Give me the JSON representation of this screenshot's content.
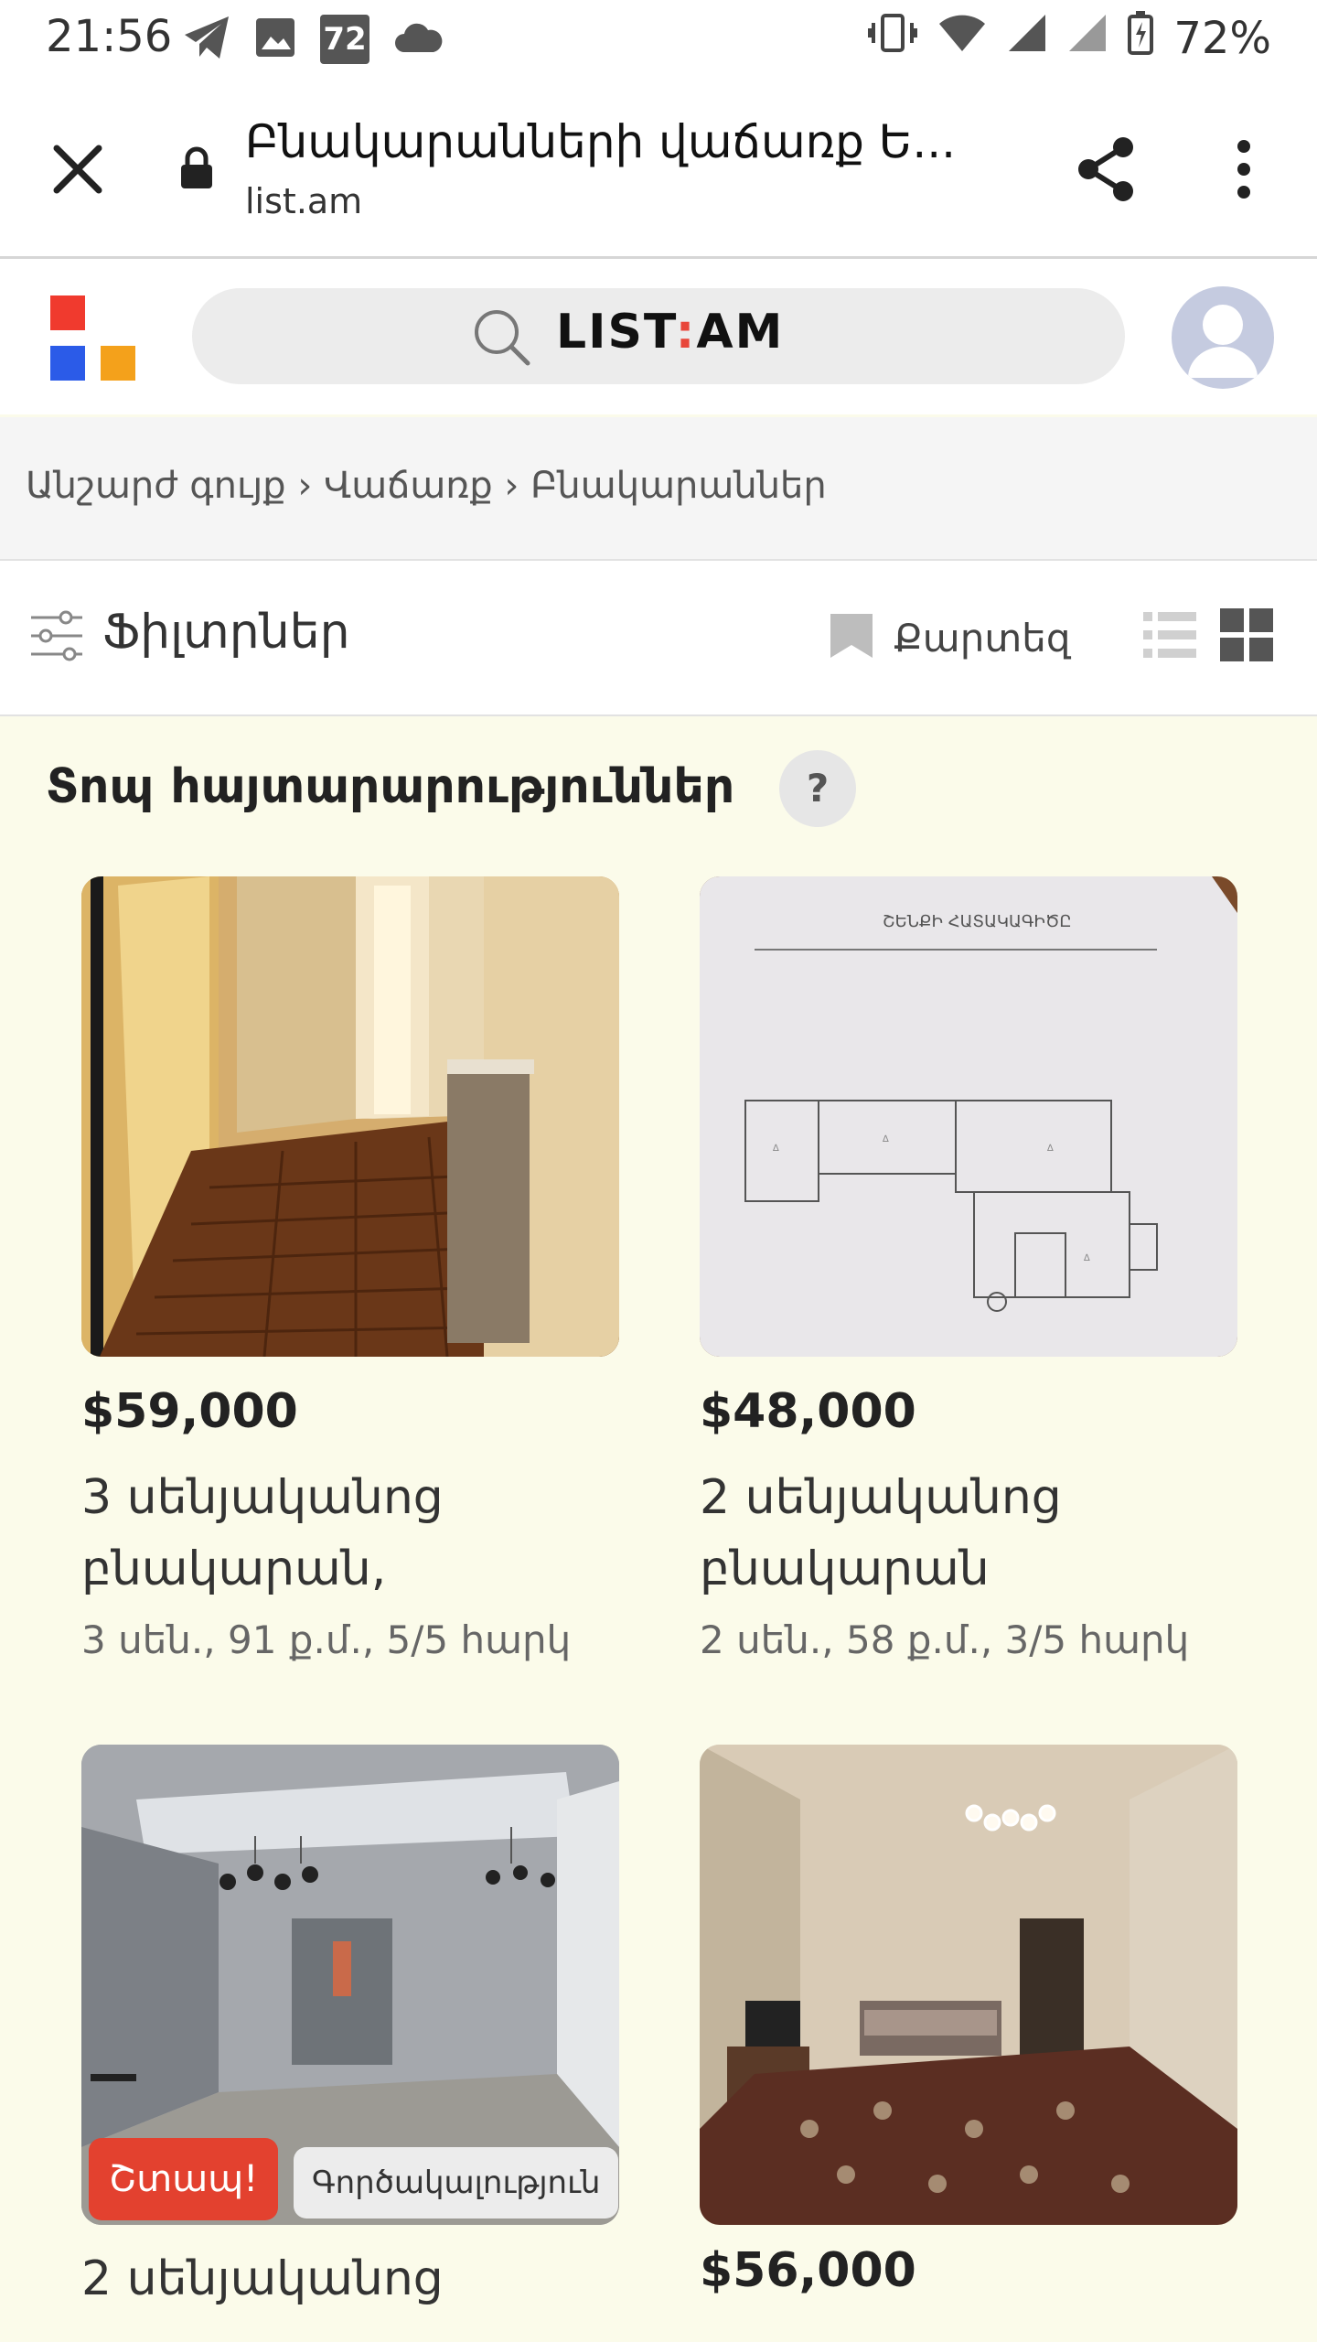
{
  "status_bar": {
    "time": "21:56",
    "notification_icons": [
      "telegram-icon",
      "image-icon",
      "aqi-72-icon",
      "cloud-icon"
    ],
    "aqi_value": "72",
    "right_icons": [
      "vibrate-icon",
      "wifi-icon",
      "signal-icon",
      "signal-icon",
      "battery-icon"
    ],
    "battery": "72%"
  },
  "browser": {
    "page_title": "Բնակարանների վաճառք Ե...",
    "domain": "list.am"
  },
  "site_header": {
    "search_logo_left": "LIST",
    "search_logo_colon": ":",
    "search_logo_right": "AM",
    "logo_colors": [
      "#f03a2e",
      "#f4a11b",
      "#2b5be8"
    ]
  },
  "breadcrumb": {
    "items": [
      "Անշարժ գույք",
      "Վաճառք",
      "Բնակարաններ"
    ],
    "separator": "›"
  },
  "toolbar": {
    "filters_label": "Ֆիլտրներ",
    "map_label": "Քարտեզ"
  },
  "section": {
    "title": "Տոպ հայտարարություններ",
    "help": "?"
  },
  "listings": [
    {
      "price": "$59,000",
      "title": "3 սենյականոց բնակարան,",
      "meta": "3 սեն., 91 ք.մ., 5/5 հարկ"
    },
    {
      "price": "$48,000",
      "title": "2 սենյականոց բնակարան",
      "meta": "2 սեն., 58 ք.մ., 3/5 հարկ",
      "plan_heading": "ՇԵՆՔԻ ՀԱՏԱԿԱԳԻԾԸ"
    },
    {
      "title": "2 սենյականոց",
      "badges": [
        "Շտապ!",
        "Գործակալություն"
      ]
    },
    {
      "price": "$56,000"
    }
  ]
}
